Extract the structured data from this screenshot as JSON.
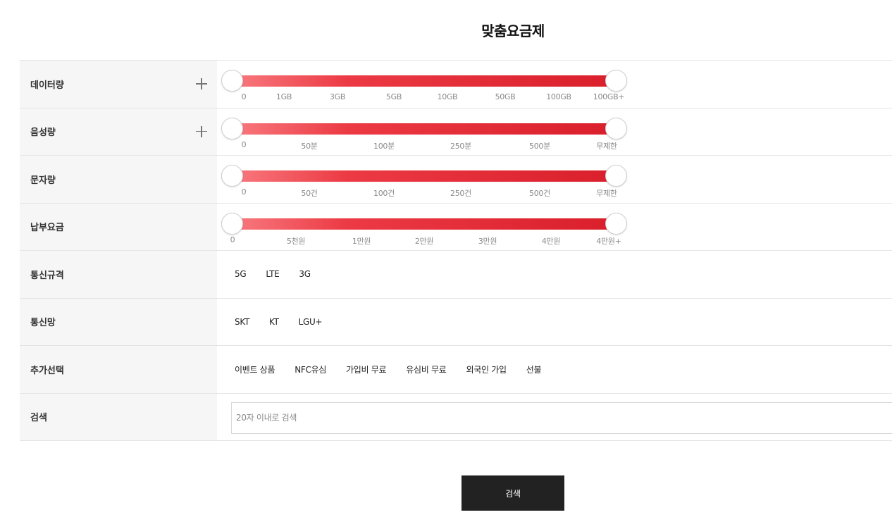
{
  "title": "맞춤요금제",
  "filters": {
    "data": {
      "label": "데이터량",
      "ticks": [
        "0",
        "1GB",
        "3GB",
        "5GB",
        "10GB",
        "50GB",
        "100GB",
        "100GB+"
      ],
      "range": {
        "min": 0,
        "max": 1
      }
    },
    "voice": {
      "label": "음성량",
      "ticks": [
        "0",
        "50분",
        "100분",
        "250분",
        "500분",
        "무제한"
      ],
      "range": {
        "min": 0,
        "max": 1
      }
    },
    "sms": {
      "label": "문자량",
      "ticks": [
        "0",
        "50건",
        "100건",
        "250건",
        "500건",
        "무제한"
      ],
      "range": {
        "min": 0,
        "max": 1
      }
    },
    "fee": {
      "label": "납부요금",
      "ticks": [
        "0",
        "5천원",
        "1만원",
        "2만원",
        "3만원",
        "4만원",
        "4만원+"
      ],
      "range": {
        "min": 0,
        "max": 1
      }
    },
    "network_type": {
      "label": "통신규격",
      "options": [
        "5G",
        "LTE",
        "3G"
      ]
    },
    "carrier": {
      "label": "통신망",
      "options": [
        "SKT",
        "KT",
        "LGU+"
      ]
    },
    "extra": {
      "label": "추가선택",
      "options": [
        "이벤트 상품",
        "NFC유심",
        "가입비 무료",
        "유심비 무료",
        "외국인 가입",
        "선불"
      ]
    },
    "search": {
      "label": "검색",
      "placeholder": "20자 이내로 검색",
      "value": ""
    }
  },
  "search_button_label": "검색",
  "colors": {
    "slider_start": "#f87a7f",
    "slider_end": "#d91f2b",
    "button_bg": "#222222",
    "label_bg": "#f6f6f6"
  }
}
